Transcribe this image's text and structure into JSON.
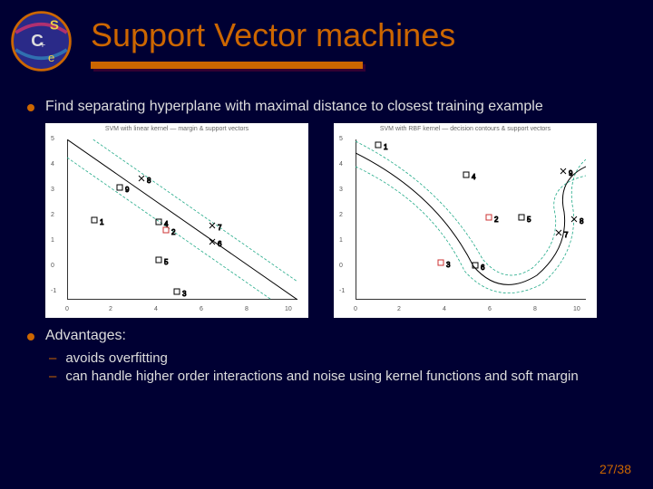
{
  "title": "Support Vector machines",
  "bullets": {
    "b1": "Find separating hyperplane with maximal distance to closest training example",
    "b2": "Advantages:",
    "sub1": "avoids overfitting",
    "sub2": "can handle higher order interactions and noise using kernel functions and soft margin"
  },
  "page": "27/38",
  "chart_data": [
    {
      "type": "scatter",
      "title": "SVM with linear kernel — margin & support vectors",
      "xlim": [
        0,
        10
      ],
      "ylim": [
        -1,
        5
      ],
      "xticks": [
        0,
        2,
        4,
        6,
        8,
        10
      ],
      "yticks": [
        -1,
        0,
        1,
        2,
        3,
        4,
        5
      ],
      "boundary": {
        "type": "line",
        "p1": [
          0,
          5
        ],
        "p2": [
          10,
          -1
        ]
      },
      "margins": [
        {
          "p1": [
            0,
            4.3
          ],
          "p2": [
            10,
            -1.7
          ]
        },
        {
          "p1": [
            0,
            5.7
          ],
          "p2": [
            10,
            -0.3
          ]
        }
      ],
      "series": [
        {
          "name": "class-x",
          "marker": "x",
          "points": [
            [
              3.2,
              3.6,
              8
            ],
            [
              6.3,
              1.8,
              7
            ],
            [
              6.3,
              1.2,
              6
            ]
          ]
        },
        {
          "name": "class-o",
          "marker": "o",
          "points": [
            [
              2.3,
              3.2,
              9
            ],
            [
              4.0,
              1.9,
              4
            ],
            [
              4.3,
              1.6,
              2
            ],
            [
              4.0,
              0.5,
              5
            ],
            [
              4.8,
              -0.7,
              3
            ],
            [
              1.2,
              2.0,
              1
            ]
          ]
        }
      ]
    },
    {
      "type": "scatter",
      "title": "SVM with RBF kernel — decision contours & support vectors",
      "xlim": [
        0,
        10
      ],
      "ylim": [
        -1,
        5
      ],
      "xticks": [
        0,
        2,
        4,
        6,
        8,
        10
      ],
      "yticks": [
        -1,
        0,
        1,
        2,
        3,
        4,
        5
      ],
      "boundary": {
        "type": "contour"
      },
      "series": [
        {
          "name": "class-x",
          "marker": "x",
          "points": [
            [
              9.0,
              3.8,
              9
            ],
            [
              9.5,
              2.0,
              8
            ],
            [
              8.8,
              1.5,
              7
            ]
          ]
        },
        {
          "name": "class-o",
          "marker": "o",
          "points": [
            [
              4.8,
              3.7,
              4
            ],
            [
              5.8,
              2.1,
              2
            ],
            [
              7.2,
              2.1,
              5
            ],
            [
              3.7,
              0.4,
              3
            ],
            [
              5.2,
              0.3,
              6
            ],
            [
              1.0,
              4.8,
              1
            ]
          ]
        }
      ]
    }
  ]
}
